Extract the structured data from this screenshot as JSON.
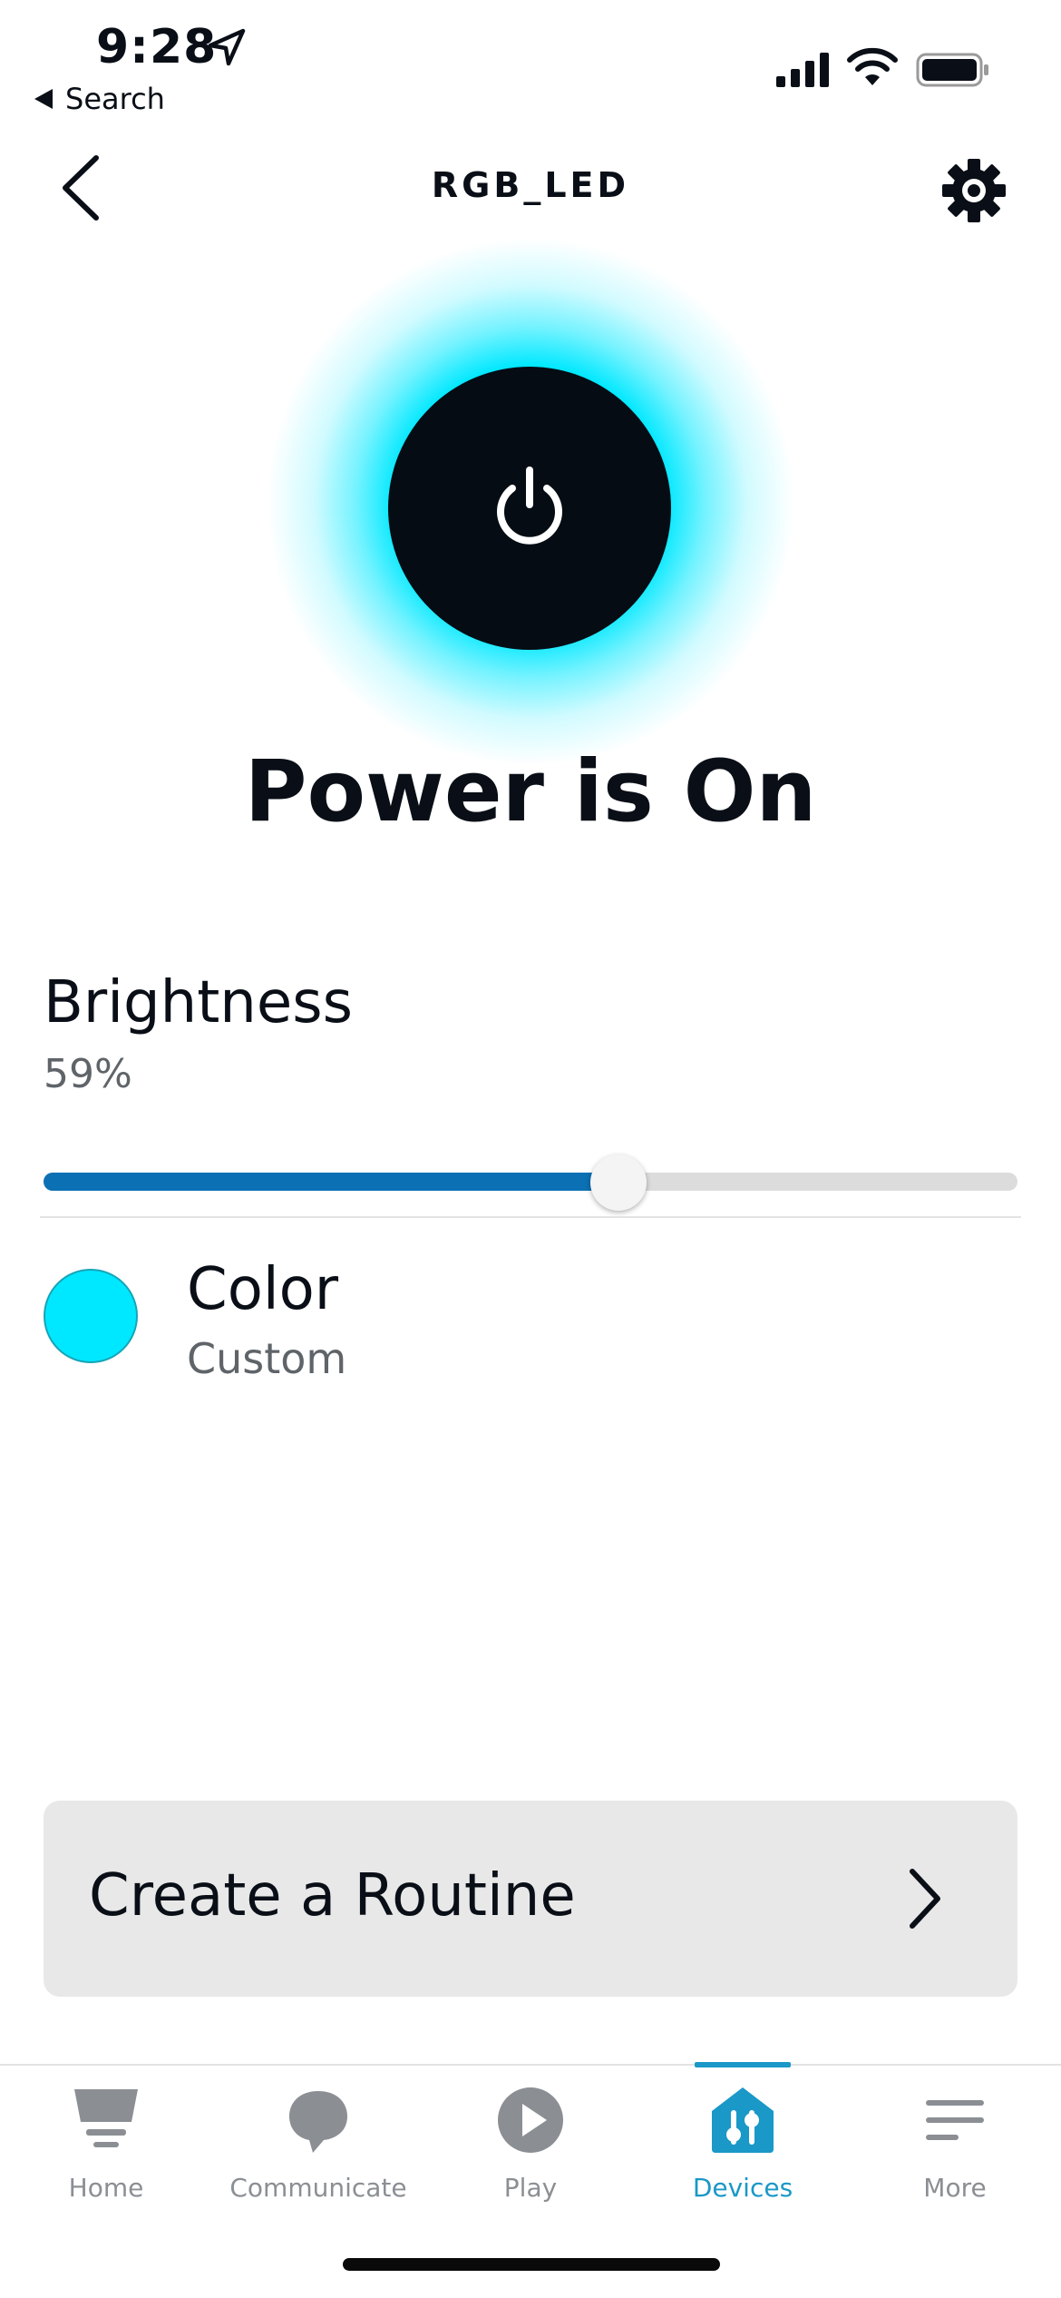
{
  "status_bar": {
    "time": "9:28",
    "back_app": "Search"
  },
  "header": {
    "title": "RGB_LED"
  },
  "power": {
    "status_text": "Power is On",
    "is_on": true,
    "glow_color": "#00e8ff"
  },
  "brightness": {
    "label": "Brightness",
    "value_text": "59%",
    "value": 0.59,
    "fill_color": "#0c70b5"
  },
  "color": {
    "label": "Color",
    "value": "Custom",
    "swatch_color": "#00e8ff"
  },
  "routine": {
    "label": "Create a Routine"
  },
  "tabs": [
    {
      "label": "Home",
      "icon": "home-icon",
      "active": false
    },
    {
      "label": "Communicate",
      "icon": "communicate-icon",
      "active": false
    },
    {
      "label": "Play",
      "icon": "play-icon",
      "active": false
    },
    {
      "label": "Devices",
      "icon": "devices-icon",
      "active": true
    },
    {
      "label": "More",
      "icon": "more-icon",
      "active": false
    }
  ],
  "colors": {
    "accent": "#1a98c7",
    "inactive_tab": "#8b8f94"
  }
}
